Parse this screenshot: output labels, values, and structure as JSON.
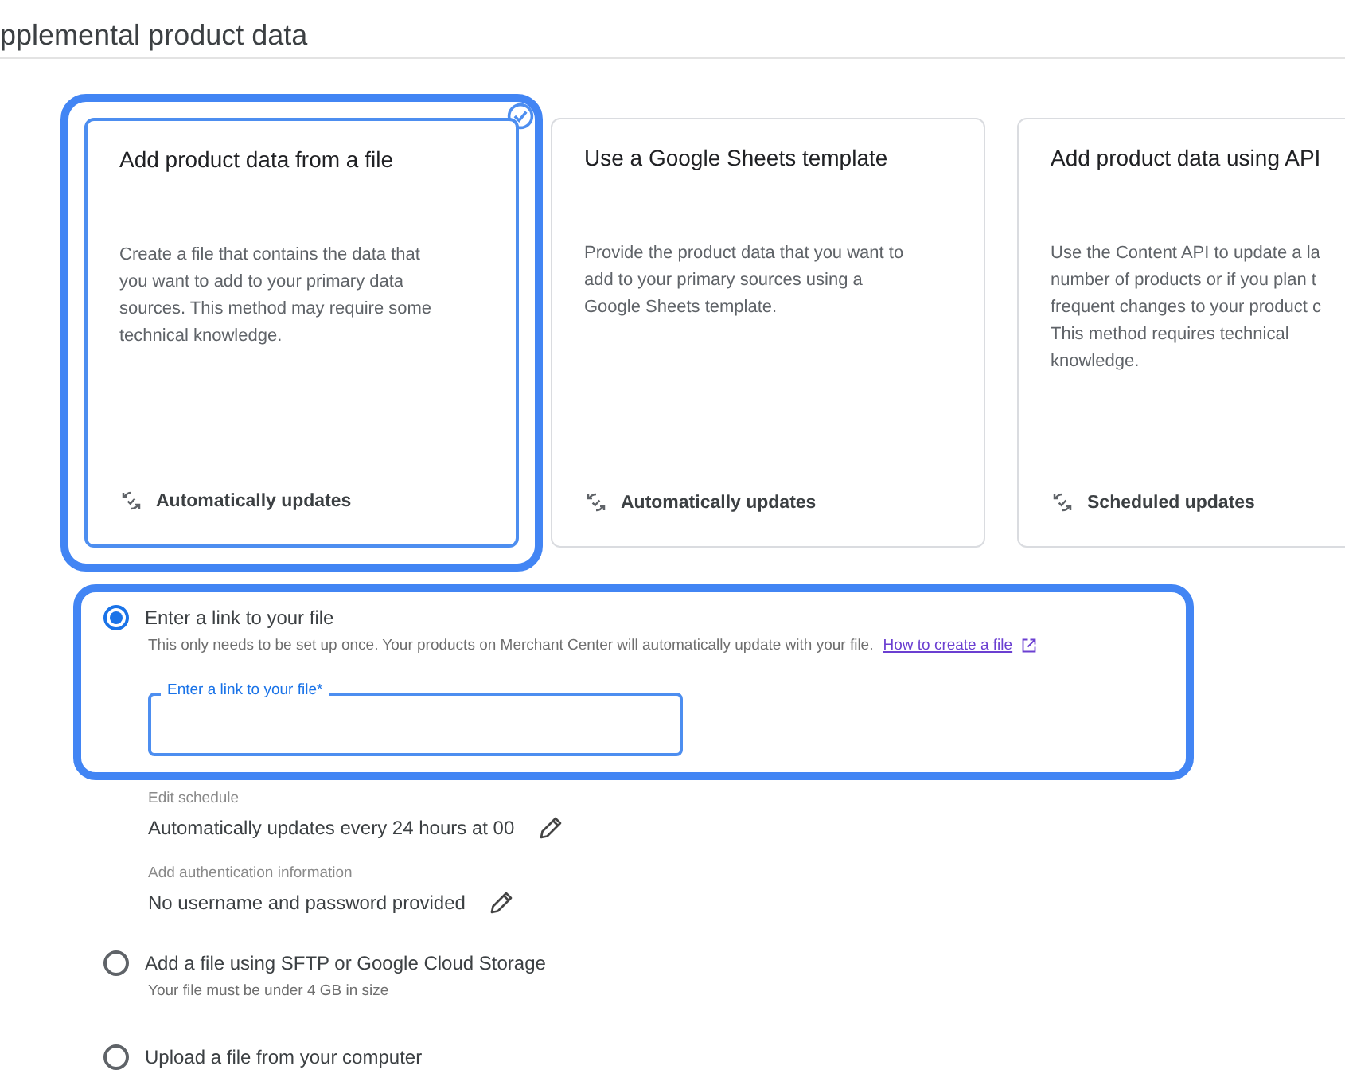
{
  "page": {
    "title": "pplemental product data"
  },
  "cards": [
    {
      "title": "Add product data from a file",
      "description_lines": [
        "Create a file that contains the data that",
        "you want to add to your primary data",
        "sources. This method may require some",
        "technical knowledge."
      ],
      "footer": "Automatically updates",
      "selected": true,
      "highlighted": true
    },
    {
      "title": "Use a Google Sheets template",
      "description_lines": [
        "Provide the product data that you want to",
        "add to your primary sources using a",
        "Google Sheets template."
      ],
      "footer": "Automatically updates",
      "selected": false,
      "highlighted": false
    },
    {
      "title": "Add product data using API",
      "description_lines": [
        "Use the Content API to update a la",
        "number of products or if you plan t",
        "frequent changes to your product c",
        "This method requires technical",
        "knowledge."
      ],
      "footer": "Scheduled updates",
      "selected": false,
      "highlighted": false
    }
  ],
  "options": [
    {
      "label": "Enter a link to your file",
      "selected": true,
      "highlighted": true,
      "description": "This only needs to be set up once. Your products on Merchant Center will automatically update with your file.",
      "link": "How to create a file",
      "field": {
        "label": "Enter a link to your file*"
      },
      "settings": [
        {
          "label": "Edit schedule",
          "value": "Automatically updates every 24 hours at 00"
        },
        {
          "label": "Add authentication information",
          "value": "No username and password provided"
        }
      ]
    },
    {
      "label": "Add a file using SFTP or Google Cloud Storage",
      "selected": false,
      "highlighted": false,
      "description": "Your file must be under 4 GB in size"
    },
    {
      "label": "Upload a file from your computer",
      "selected": false,
      "highlighted": false
    }
  ]
}
